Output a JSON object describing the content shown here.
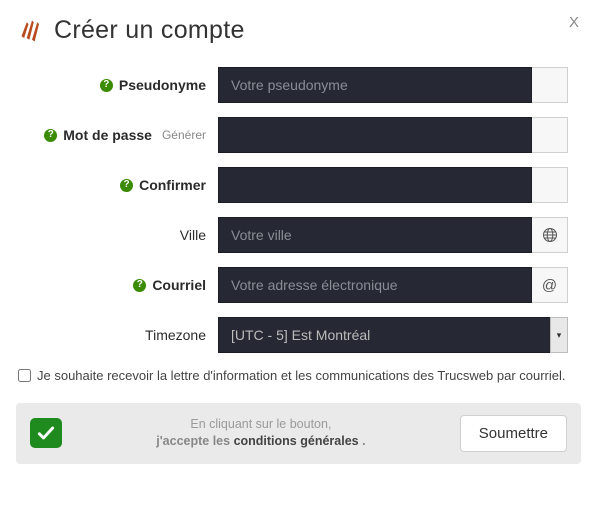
{
  "title": "Créer un compte",
  "close_label": "X",
  "fields": {
    "pseudonym": {
      "label": "Pseudonyme",
      "placeholder": "Votre pseudonyme",
      "has_help": true
    },
    "password": {
      "label": "Mot de passe",
      "generate": "Générer",
      "has_help": true
    },
    "confirm": {
      "label": "Confirmer",
      "has_help": true
    },
    "city": {
      "label": "Ville",
      "placeholder": "Votre ville",
      "addon_icon": "globe"
    },
    "email": {
      "label": "Courriel",
      "placeholder": "Votre adresse électronique",
      "addon_text": "@",
      "has_help": true
    },
    "timezone": {
      "label": "Timezone",
      "selected": "[UTC - 5] Est Montréal"
    }
  },
  "newsletter": {
    "text": "Je souhaite recevoir la lettre d'information et les communications des Trucsweb par courriel.",
    "checked": false
  },
  "footer": {
    "line1": "En cliquant sur le bouton,",
    "line2_prefix": "j'accepte les ",
    "terms_link": "conditions générales",
    "line2_suffix": " .",
    "submit": "Soumettre"
  }
}
